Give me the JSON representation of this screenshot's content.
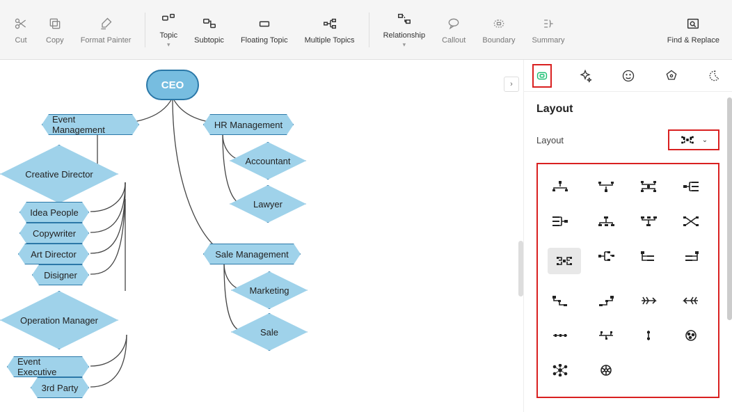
{
  "toolbar": {
    "cut": "Cut",
    "copy": "Copy",
    "format_painter": "Format Painter",
    "topic": "Topic",
    "subtopic": "Subtopic",
    "floating_topic": "Floating Topic",
    "multiple_topics": "Multiple Topics",
    "relationship": "Relationship",
    "callout": "Callout",
    "boundary": "Boundary",
    "summary": "Summary",
    "find_replace": "Find & Replace"
  },
  "mindmap": {
    "root": "CEO",
    "left": {
      "branch": "Event Management",
      "child1": "Creative Director",
      "c1_children": [
        "Idea People",
        "Copywriter",
        "Art Director",
        "Disigner"
      ],
      "child2": "Operation Manager",
      "c2_children": [
        "Event Executive",
        "3rd Party"
      ]
    },
    "right_top": {
      "branch": "HR Management",
      "children": [
        "Accountant",
        "Lawyer"
      ]
    },
    "right_bottom": {
      "branch": "Sale Management",
      "children": [
        "Marketing",
        "Sale"
      ]
    }
  },
  "panel": {
    "title": "Layout",
    "layout_label": "Layout"
  }
}
